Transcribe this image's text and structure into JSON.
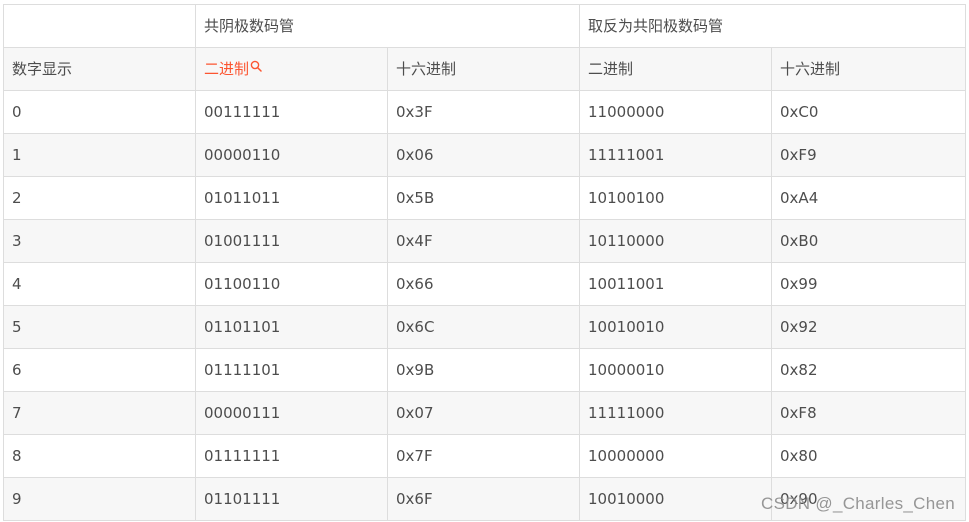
{
  "header_top": {
    "c0": "",
    "c1": "共阴极数码管",
    "c3": "取反为共阳极数码管"
  },
  "header_sub": {
    "c0": "数字显示",
    "c1": "二进制",
    "c2": "十六进制",
    "c3": "二进制",
    "c4": "十六进制"
  },
  "rows": [
    [
      "0",
      "00111111",
      "0x3F",
      "11000000",
      "0xC0"
    ],
    [
      "1",
      "00000110",
      "0x06",
      "11111001",
      "0xF9"
    ],
    [
      "2",
      "01011011",
      "0x5B",
      "10100100",
      "0xA4"
    ],
    [
      "3",
      "01001111",
      "0x4F",
      "10110000",
      "0xB0"
    ],
    [
      "4",
      "01100110",
      "0x66",
      "10011001",
      "0x99"
    ],
    [
      "5",
      "01101101",
      "0x6C",
      "10010010",
      "0x92"
    ],
    [
      "6",
      "01111101",
      "0x9B",
      "10000010",
      "0x82"
    ],
    [
      "7",
      "00000111",
      "0x07",
      "11111000",
      "0xF8"
    ],
    [
      "8",
      "01111111",
      "0x7F",
      "10000000",
      "0x80"
    ],
    [
      "9",
      "01101111",
      "0x6F",
      "10010000",
      "0x90"
    ]
  ],
  "watermark": "CSDN @_Charles_Chen",
  "colors": {
    "keyword": "#fc5531",
    "text": "#4d4d4d",
    "border": "#dddddd",
    "stripe": "#f7f7f7"
  },
  "icons": {
    "keyword_search": "search-icon"
  }
}
